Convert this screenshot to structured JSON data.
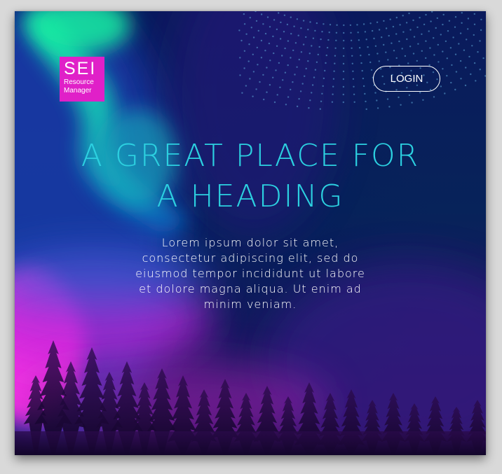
{
  "brand": {
    "logo_line1": "SEI",
    "logo_line2": "Resource",
    "logo_line3": "Manager",
    "logo_color": "#e020c8"
  },
  "header": {
    "login_label": "LOGIN"
  },
  "hero": {
    "heading": "A GREAT PLACE FOR A HEADING",
    "body": "Lorem ipsum dolor sit amet, consectetur adipiscing elit, sed do eiusmod tempor incididunt ut labore et dolore magna aliqua. Ut enim ad minim veniam.",
    "heading_color": "#2cd0e0"
  },
  "background": {
    "theme": "northern-lights-over-forest",
    "colors": [
      "#07235a",
      "#18e0a0",
      "#e030e0",
      "#2b0f5c"
    ]
  }
}
